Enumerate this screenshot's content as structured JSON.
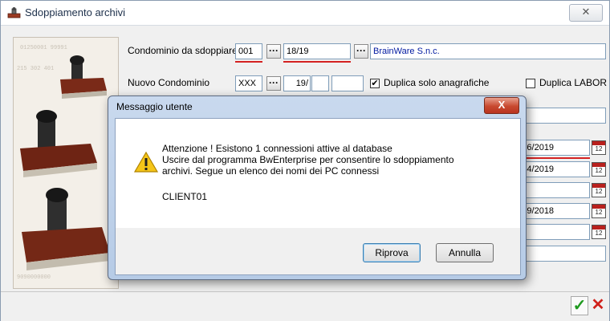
{
  "window": {
    "title": "Sdoppiamento archivi",
    "close_label": "✕"
  },
  "form": {
    "condominio_label": "Condominio da sdoppiare",
    "condominio_code": "001",
    "condominio_year": "18/19",
    "condominio_name": "BrainWare S.n.c.",
    "nuovo_label": "Nuovo Condominio",
    "nuovo_code": "XXX",
    "nuovo_year_a": "19",
    "nuovo_year_sep": "/",
    "nuovo_year_b": "",
    "nuovo_extra": "",
    "duplica_anagrafiche_label": "Duplica solo anagrafiche",
    "duplica_labor_label": "Duplica LABOR",
    "dates": [
      "30/06/2019",
      "30/04/2019",
      "",
      "15/09/2018",
      ""
    ],
    "ellipsis": "···"
  },
  "dialog": {
    "title": "Messaggio utente",
    "close_label": "X",
    "lines": [
      "Attenzione ! Esistono 1 connessioni attive al database",
      "Uscire dal programma BwEnterprise per consentire lo sdoppiamento",
      "archivi. Segue un elenco dei nomi dei PC connessi"
    ],
    "client": "CLIENT01",
    "retry_label": "Riprova",
    "cancel_label": "Annulla"
  },
  "footer": {
    "ok_symbol": "✓",
    "cancel_symbol": "✕"
  },
  "colors": {
    "accent_red": "#d42222",
    "ok_green": "#1f9a1f"
  }
}
